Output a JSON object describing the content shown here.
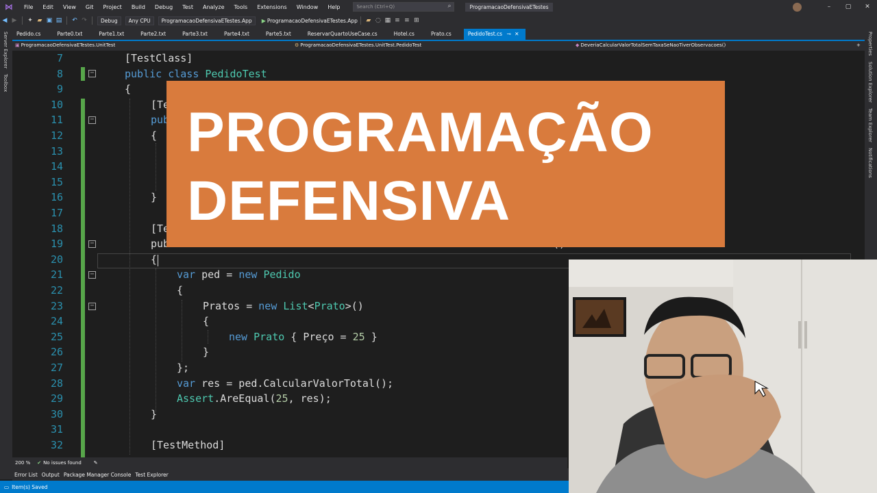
{
  "menubar": {
    "items": [
      "File",
      "Edit",
      "View",
      "Git",
      "Project",
      "Build",
      "Debug",
      "Test",
      "Analyze",
      "Tools",
      "Extensions",
      "Window",
      "Help"
    ],
    "search_placeholder": "Search (Ctrl+Q)",
    "solution_title": "ProgramacaoDefensivaETestes"
  },
  "toolbar": {
    "config": "Debug",
    "platform": "Any CPU",
    "startup_project": "ProgramacaoDefensivaETestes.App",
    "run_target": "ProgramacaoDefensivaETestes.App"
  },
  "tabs": [
    "Pedido.cs",
    "Parte0.txt",
    "Parte1.txt",
    "Parte2.txt",
    "Parte3.txt",
    "Parte4.txt",
    "Parte5.txt",
    "ReservarQuartoUseCase.cs",
    "Hotel.cs",
    "Prato.cs",
    "PedidoTest.cs"
  ],
  "active_tab": "PedidoTest.cs",
  "navbar": {
    "project": "ProgramacaoDefensivaETestes.UnitTest",
    "class": "ProgramacaoDefensivaETestes.UnitTest.PedidoTest",
    "member": "DeveriaCalcularValorTotalSemTaxaSeNaoTiverObservacoes()"
  },
  "side_panels": {
    "left": [
      "Server Explorer",
      "Toolbox"
    ],
    "right": [
      "Properties",
      "Solution Explorer",
      "Team Explorer",
      "Notifications"
    ]
  },
  "line_numbers": [
    "7",
    "8",
    "9",
    "10",
    "11",
    "12",
    "13",
    "14",
    "15",
    "16",
    "17",
    "18",
    "19",
    "20",
    "21",
    "22",
    "23",
    "24",
    "25",
    "26",
    "27",
    "28",
    "29",
    "30",
    "31",
    "32"
  ],
  "code": {
    "l7": "[TestClass]",
    "l8_kw": "public class ",
    "l8_name": "PedidoTest",
    "l9": "{",
    "l10": "[Te",
    "l11": "publ",
    "l12": "{",
    "l16": "}",
    "l18": "[Te",
    "l19": "public void DeveriaCalcularValorTotalSemTaxaSeNaoTiverObservacoes()",
    "l20": "{",
    "l21_kw": "var",
    "l21_mid": " ped = ",
    "l21_new": "new ",
    "l21_type": "Pedido",
    "l22": "{",
    "l23_a": "Pratos = ",
    "l23_new": "new ",
    "l23_type": "List",
    "l23_lt": "<",
    "l23_type2": "Prato",
    "l23_end": ">()",
    "l24": "{",
    "l25_new": "new ",
    "l25_type": "Prato",
    "l25_mid": " { Preço = ",
    "l25_num": "25",
    "l25_end": " }",
    "l26": "}",
    "l27": "};",
    "l28_kw": "var",
    "l28_rest": " res = ped.CalcularValorTotal();",
    "l29_type": "Assert",
    "l29_rest": ".AreEqual(",
    "l29_num": "25",
    "l29_end": ", res);",
    "l30": "}",
    "l32": "[TestMethod]"
  },
  "editor_footer": {
    "zoom": "200 %",
    "issues": "No issues found"
  },
  "tool_windows": [
    "Error List",
    "Output",
    "Package Manager Console",
    "Test Explorer"
  ],
  "statusbar": {
    "message": "Item(s) Saved"
  },
  "banner": {
    "line1": "PROGRAMAÇÃO",
    "line2": "DEFENSIVA",
    "color": "#d97b3d"
  },
  "colors": {
    "accent": "#007acc",
    "keyword": "#569cd6",
    "type": "#4ec9b0",
    "number": "#b5cea8",
    "line_number": "#2b91af"
  }
}
